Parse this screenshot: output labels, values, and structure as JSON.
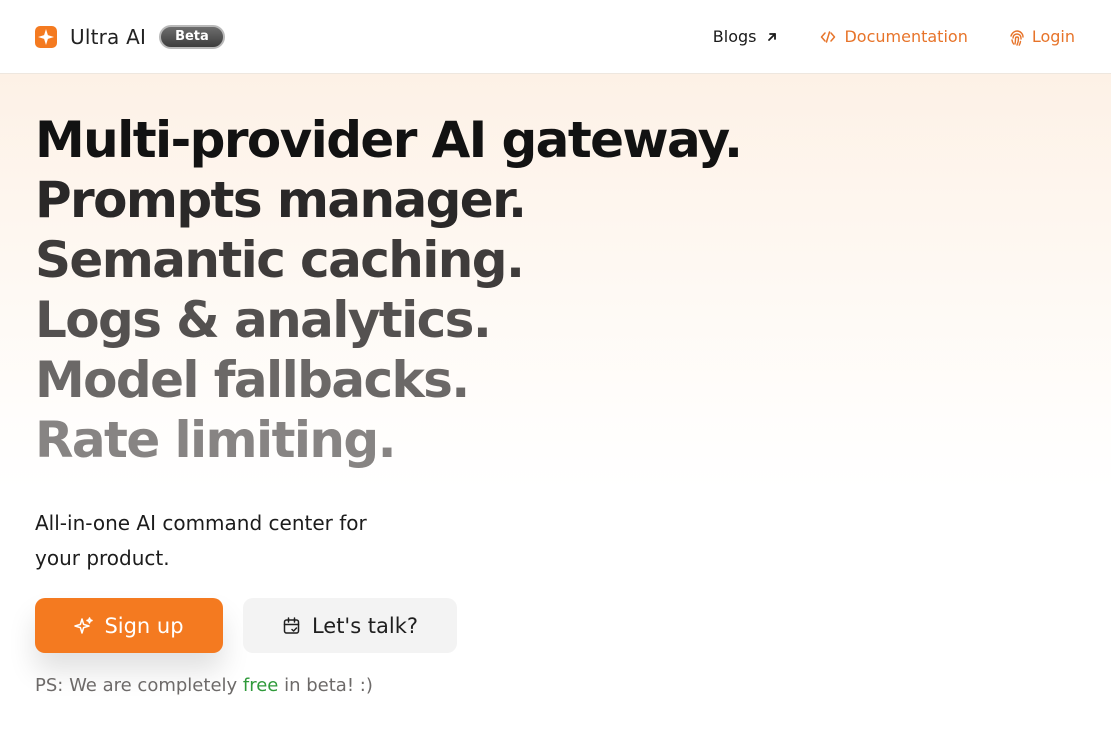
{
  "colors": {
    "accent": "#f47a20",
    "link_accent": "#e7742a",
    "free_green": "#2f9a3a"
  },
  "header": {
    "brand_name": "Ultra AI",
    "badge": "Beta",
    "logo_icon": "sparkle-square-logo",
    "nav": {
      "blogs": {
        "label": "Blogs",
        "icon": "arrow-up-right-icon"
      },
      "docs": {
        "label": "Documentation",
        "icon": "code-icon"
      },
      "login": {
        "label": "Login",
        "icon": "fingerprint-icon"
      }
    }
  },
  "hero": {
    "headlines": [
      "Multi-provider AI gateway.",
      "Prompts manager.",
      "Semantic caching.",
      "Logs & analytics.",
      "Model fallbacks.",
      "Rate limiting."
    ],
    "subtext": "All-in-one AI command center for your product.",
    "buttons": {
      "signup": {
        "label": "Sign up",
        "icon": "sparkles-icon"
      },
      "talk": {
        "label": "Let's talk?",
        "icon": "calendar-icon"
      }
    },
    "ps": {
      "prefix": "PS: We are completely ",
      "highlight": "free",
      "suffix": " in beta! :)"
    }
  }
}
